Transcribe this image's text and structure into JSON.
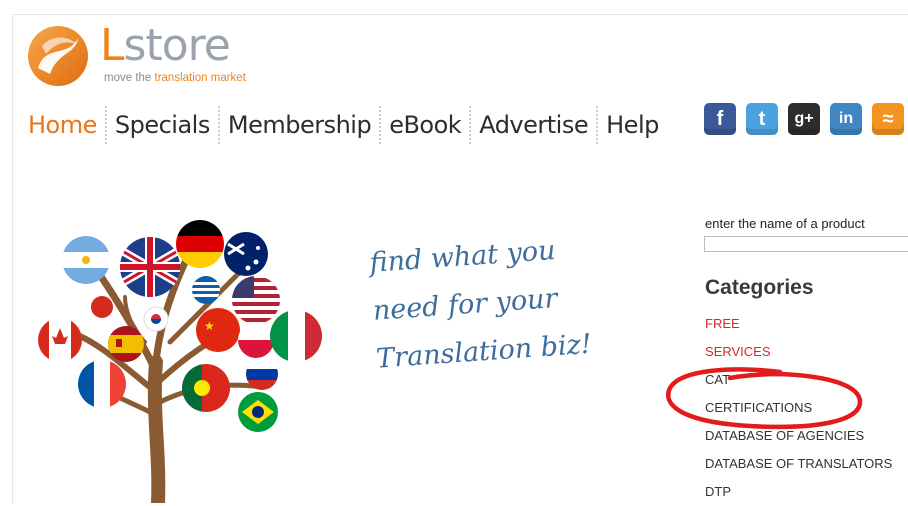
{
  "logo": {
    "wordmark_first": "L",
    "wordmark_rest": "store",
    "tagline_prefix": "move the ",
    "tagline_accent": "translation market"
  },
  "nav": {
    "items": [
      {
        "label": "Home",
        "active": true
      },
      {
        "label": "Specials"
      },
      {
        "label": "Membership"
      },
      {
        "label": "eBook"
      },
      {
        "label": "Advertise"
      },
      {
        "label": "Help"
      }
    ]
  },
  "social": {
    "items": [
      {
        "name": "facebook-icon",
        "glyph": "f",
        "color": "#3b5998"
      },
      {
        "name": "twitter-icon",
        "glyph": "t",
        "color": "#4aa3df"
      },
      {
        "name": "google-plus-icon",
        "glyph": "g+",
        "color": "#2d2d2d"
      },
      {
        "name": "linkedin-icon",
        "glyph": "in",
        "color": "#3f86c2"
      },
      {
        "name": "rss-icon",
        "glyph": "≈",
        "color": "#f39322"
      }
    ]
  },
  "hero": {
    "slogan_lines": [
      "find what you",
      "need for your",
      "Translation biz!"
    ]
  },
  "search": {
    "label": "enter the name of a product",
    "value": ""
  },
  "categories": {
    "title": "Categories",
    "items": [
      {
        "label": "FREE",
        "color": "#d8282b"
      },
      {
        "label": "SERVICES",
        "color": "#d8282b"
      },
      {
        "label": "CAT"
      },
      {
        "label": "CERTIFICATIONS"
      },
      {
        "label": "DATABASE OF AGENCIES"
      },
      {
        "label": "DATABASE OF TRANSLATORS"
      },
      {
        "label": "DTP"
      }
    ]
  },
  "colors": {
    "brand_orange": "#f0821e",
    "nav_active": "#e8761c",
    "slogan_blue": "#3e6c9c",
    "category_red": "#d8282b",
    "annotation_red": "#e31b1b"
  }
}
